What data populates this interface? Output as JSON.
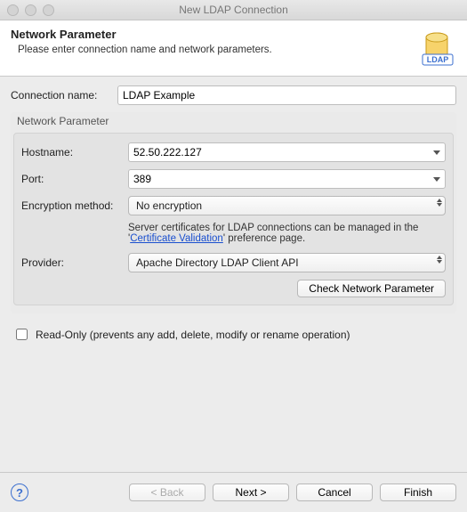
{
  "window": {
    "title": "New LDAP Connection"
  },
  "banner": {
    "heading": "Network Parameter",
    "subtitle": "Please enter connection name and network parameters.",
    "icon_label": "LDAP"
  },
  "connection": {
    "name_label": "Connection name:",
    "name_value": "LDAP Example"
  },
  "network": {
    "group_title": "Network Parameter",
    "hostname_label": "Hostname:",
    "hostname_value": "52.50.222.127",
    "port_label": "Port:",
    "port_value": "389",
    "encryption_label": "Encryption method:",
    "encryption_value": "No encryption",
    "cert_hint_prefix": "Server certificates for LDAP connections can be managed in the '",
    "cert_hint_link": "Certificate Validation",
    "cert_hint_suffix": "' preference page.",
    "provider_label": "Provider:",
    "provider_value": "Apache Directory LDAP Client API",
    "check_btn": "Check Network Parameter"
  },
  "readonly": {
    "label": "Read-Only (prevents any add, delete, modify or rename operation)",
    "checked": false
  },
  "footer": {
    "back": "< Back",
    "next": "Next >",
    "cancel": "Cancel",
    "finish": "Finish"
  }
}
